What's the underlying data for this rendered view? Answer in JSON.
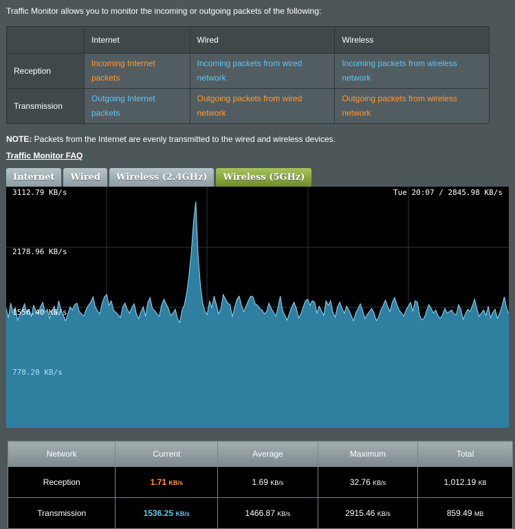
{
  "intro": "Traffic Monitor allows you to monitor the incoming or outgoing packets of the following:",
  "legend": {
    "headers": [
      "Internet",
      "Wired",
      "Wireless"
    ],
    "rows": [
      {
        "label": "Reception",
        "cells": [
          "Incoming Internet packets",
          "Incoming packets from wired network",
          "Incoming packets from wireless network"
        ]
      },
      {
        "label": "Transmission",
        "cells": [
          "Outgoing Internet packets",
          "Outgoing packets from wired network",
          "Outgoing packets from wireless network"
        ]
      }
    ]
  },
  "note_label": "NOTE:",
  "note_text": " Packets from the Internet are evenly transmitted to the wired and wireless devices.",
  "faq_link": "Traffic Monitor FAQ",
  "tabs": [
    "Internet",
    "Wired",
    "Wireless (2.4GHz)",
    "Wireless (5GHz)"
  ],
  "active_tab": "Wireless (5GHz)",
  "chart": {
    "y_labels": [
      "3112.79 KB/s",
      "2178.96 KB/s",
      "1556.40 KB/s",
      "778.20 KB/s"
    ],
    "timestamp": "Tue 20:07 / 2845.98 KB/s"
  },
  "chart_data": {
    "type": "area",
    "ylim": [
      0,
      3112.79
    ],
    "ylabel": "",
    "series": [
      {
        "values": [
          1540,
          1420,
          1610,
          1480,
          1550,
          1390,
          1460,
          1520,
          1600,
          1480,
          1530,
          1440,
          1580,
          1510,
          1470,
          1560,
          1620,
          1490,
          1530,
          1410,
          1500,
          1570,
          1460,
          1640,
          1520,
          1450,
          1380,
          1470,
          1560,
          1520,
          1590,
          1610,
          1500,
          1470,
          1440,
          1530,
          1580,
          1620,
          1690,
          1560,
          1510,
          1470,
          1610,
          1690,
          1720,
          1580,
          1640,
          1520,
          1490,
          1460,
          1420,
          1560,
          1610,
          1530,
          1480,
          1550,
          1600,
          1470,
          1410,
          1500,
          1560,
          1440,
          1620,
          1680,
          1540,
          1510,
          1470,
          1440,
          1580,
          1660,
          1600,
          1540,
          1450,
          1480,
          1530,
          1410,
          1360,
          1520,
          1590,
          1740,
          1960,
          2250,
          2660,
          2920,
          2230,
          1850,
          1610,
          1500,
          1460,
          1640,
          1550,
          1700,
          1590,
          1470,
          1540,
          1720,
          1660,
          1610,
          1590,
          1430,
          1560,
          1660,
          1700,
          1580,
          1500,
          1570,
          1640,
          1700,
          1690,
          1600,
          1580,
          1540,
          1520,
          1470,
          1500,
          1610,
          1540,
          1490,
          1440,
          1560,
          1700,
          1510,
          1450,
          1390,
          1480,
          1560,
          1620,
          1540,
          1420,
          1470,
          1560,
          1640,
          1660,
          1580,
          1640,
          1620,
          1480,
          1570,
          1510,
          1450,
          1640,
          1580,
          1640,
          1490,
          1430,
          1560,
          1620,
          1540,
          1480,
          1570,
          1520,
          1450,
          1380,
          1480,
          1540,
          1600,
          1520,
          1410,
          1460,
          1500,
          1540,
          1480,
          1380,
          1430,
          1520,
          1580,
          1650,
          1560,
          1500,
          1620,
          1680,
          1590,
          1520,
          1480,
          1440,
          1520,
          1570,
          1620,
          1500,
          1640,
          1620,
          1450,
          1390,
          1420,
          1510,
          1590,
          1540,
          1480,
          1520,
          1450,
          1410,
          1460,
          1540,
          1480,
          1500,
          1520,
          1470,
          1460,
          1590,
          1530,
          1400,
          1470,
          1530,
          1500,
          1570,
          1660,
          1540,
          1440,
          1480,
          1520,
          1450,
          1570,
          1420,
          1490,
          1530,
          1410,
          1480,
          1570,
          1690,
          1550,
          1470
        ]
      }
    ]
  },
  "stats": {
    "headers": [
      "Network",
      "Current",
      "Average",
      "Maximum",
      "Total"
    ],
    "rows": [
      {
        "label": "Reception",
        "current": "1.71",
        "current_unit": "KB/s",
        "average": "1.69",
        "average_unit": "KB/s",
        "maximum": "32.76",
        "maximum_unit": "KB/s",
        "total": "1,012.19",
        "total_unit": "KB"
      },
      {
        "label": "Transmission",
        "current": "1536.25",
        "current_unit": "KB/s",
        "average": "1466.87",
        "average_unit": "KB/s",
        "maximum": "2915.46",
        "maximum_unit": "KB/s",
        "total": "859.49",
        "total_unit": "MB"
      }
    ]
  },
  "colors": {
    "background": "#4d5659",
    "incoming": "#ff9a33",
    "outgoing": "#5dc7f5",
    "area_fill": "#3a90b5",
    "active_tab": "#8fad3e"
  }
}
